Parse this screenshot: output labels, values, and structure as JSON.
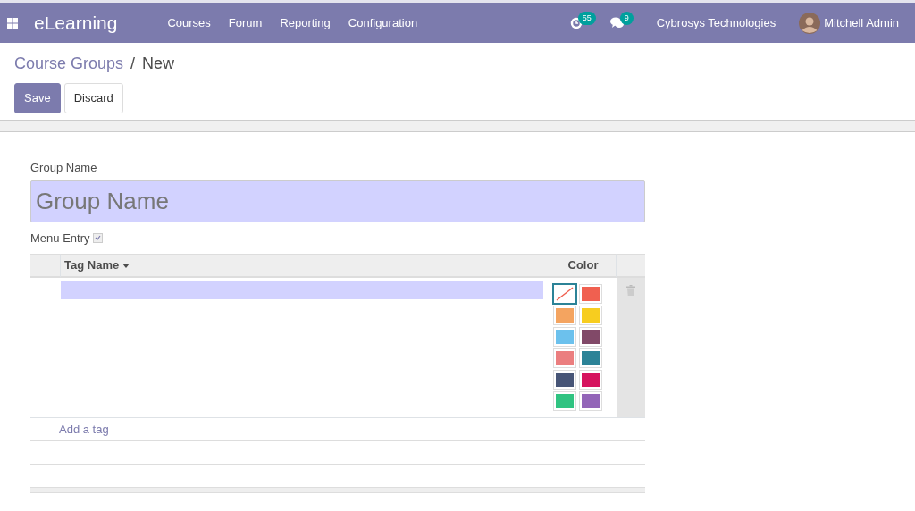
{
  "navbar": {
    "app_name": "eLearning",
    "menus": [
      "Courses",
      "Forum",
      "Reporting",
      "Configuration"
    ],
    "activity_count": "55",
    "message_count": "9",
    "company": "Cybrosys Technologies",
    "user": "Mitchell Admin"
  },
  "breadcrumb": {
    "parent": "Course Groups",
    "separator": "/",
    "current": "New"
  },
  "buttons": {
    "save": "Save",
    "discard": "Discard"
  },
  "form": {
    "group_name_label": "Group Name",
    "group_name_placeholder": "Group Name",
    "menu_entry_label": "Menu Entry",
    "menu_entry_checked": true,
    "tags": {
      "columns": [
        {
          "label": "Tag Name",
          "sorted": true
        },
        {
          "label": "Color",
          "sorted": false
        }
      ],
      "rows": [
        {
          "editing": true,
          "swatches": [
            {
              "kind": "none",
              "selected": true
            },
            {
              "kind": "color",
              "color": "#f06050",
              "selected": false
            },
            {
              "kind": "color",
              "color": "#f4a460",
              "selected": false
            },
            {
              "kind": "color",
              "color": "#f7cd1f",
              "selected": false
            },
            {
              "kind": "color",
              "color": "#6cc1ed",
              "selected": false
            },
            {
              "kind": "color",
              "color": "#814968",
              "selected": false
            },
            {
              "kind": "color",
              "color": "#eb7e7f",
              "selected": false
            },
            {
              "kind": "color",
              "color": "#2c8397",
              "selected": false
            },
            {
              "kind": "color",
              "color": "#475577",
              "selected": false
            },
            {
              "kind": "color",
              "color": "#d6145f",
              "selected": false
            },
            {
              "kind": "color",
              "color": "#30c381",
              "selected": false
            },
            {
              "kind": "color",
              "color": "#9365b8",
              "selected": false
            }
          ]
        }
      ],
      "add_label": "Add a tag"
    }
  }
}
